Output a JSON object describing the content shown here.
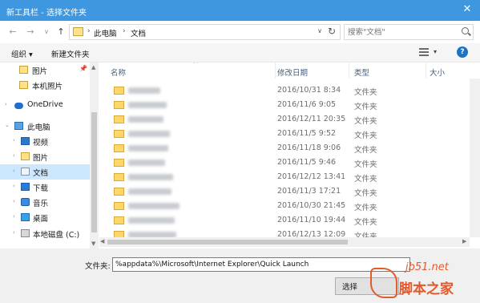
{
  "window": {
    "title": "新工具栏 - 选择文件夹",
    "close_glyph": "✕"
  },
  "address": {
    "back_glyph": "←",
    "forward_glyph": "→",
    "dropdown_glyph": "∨",
    "up_glyph": "↑",
    "crumbs": [
      "此电脑",
      "文档"
    ],
    "separator": "›",
    "dd_glyph": "∨",
    "refresh_glyph": "↻",
    "search_placeholder": "搜索\"文档\""
  },
  "toolbar": {
    "organize_label": "组织 ▾",
    "new_folder_label": "新建文件夹",
    "view_dropdown_glyph": "▾",
    "help_glyph": "?"
  },
  "sidebar": {
    "items": [
      {
        "label": "图片",
        "icon": "pictures-folder-icon",
        "pinned": true
      },
      {
        "label": "本机照片",
        "icon": "folder-icon"
      },
      {
        "label": "OneDrive",
        "icon": "onedrive-cloud-icon"
      },
      {
        "label": "此电脑",
        "icon": "computer-icon"
      },
      {
        "label": "视频",
        "icon": "videos-icon"
      },
      {
        "label": "图片",
        "icon": "pictures-icon"
      },
      {
        "label": "文档",
        "icon": "documents-icon",
        "selected": true
      },
      {
        "label": "下载",
        "icon": "downloads-icon"
      },
      {
        "label": "音乐",
        "icon": "music-icon"
      },
      {
        "label": "桌面",
        "icon": "desktop-icon"
      },
      {
        "label": "本地磁盘 (C:)",
        "icon": "disk-icon"
      }
    ],
    "pin_glyph": "📌",
    "expand_glyph": "›",
    "expanded_glyph": "⌄"
  },
  "filelist": {
    "columns": [
      "名称",
      "修改日期",
      "类型",
      "大小"
    ],
    "sort_glyph": "^",
    "rows": [
      {
        "date": "2016/10/31 8:34",
        "type": "文件夹"
      },
      {
        "date": "2016/11/6 9:05",
        "type": "文件夹"
      },
      {
        "date": "2016/12/11 20:35",
        "type": "文件夹"
      },
      {
        "date": "2016/11/5 9:52",
        "type": "文件夹"
      },
      {
        "date": "2016/11/18 9:06",
        "type": "文件夹"
      },
      {
        "date": "2016/11/5 9:46",
        "type": "文件夹"
      },
      {
        "date": "2016/12/12 13:41",
        "type": "文件夹"
      },
      {
        "date": "2016/11/3 17:21",
        "type": "文件夹"
      },
      {
        "date": "2016/10/30 21:45",
        "type": "文件夹"
      },
      {
        "date": "2016/11/10 19:44",
        "type": "文件夹"
      },
      {
        "date": "2016/12/13 12:09",
        "type": "文件夹"
      }
    ]
  },
  "scroll": {
    "up_glyph": "▲",
    "down_glyph": "▼",
    "left_glyph": "◀",
    "right_glyph": "▶"
  },
  "footer": {
    "folder_label": "文件夹:",
    "folder_value": "%appdata%\\Microsoft\\Internet Explorer\\Quick Launch",
    "select_button": "选择"
  },
  "watermark": {
    "line1": "jb51.net",
    "line2": "脚本之家"
  }
}
